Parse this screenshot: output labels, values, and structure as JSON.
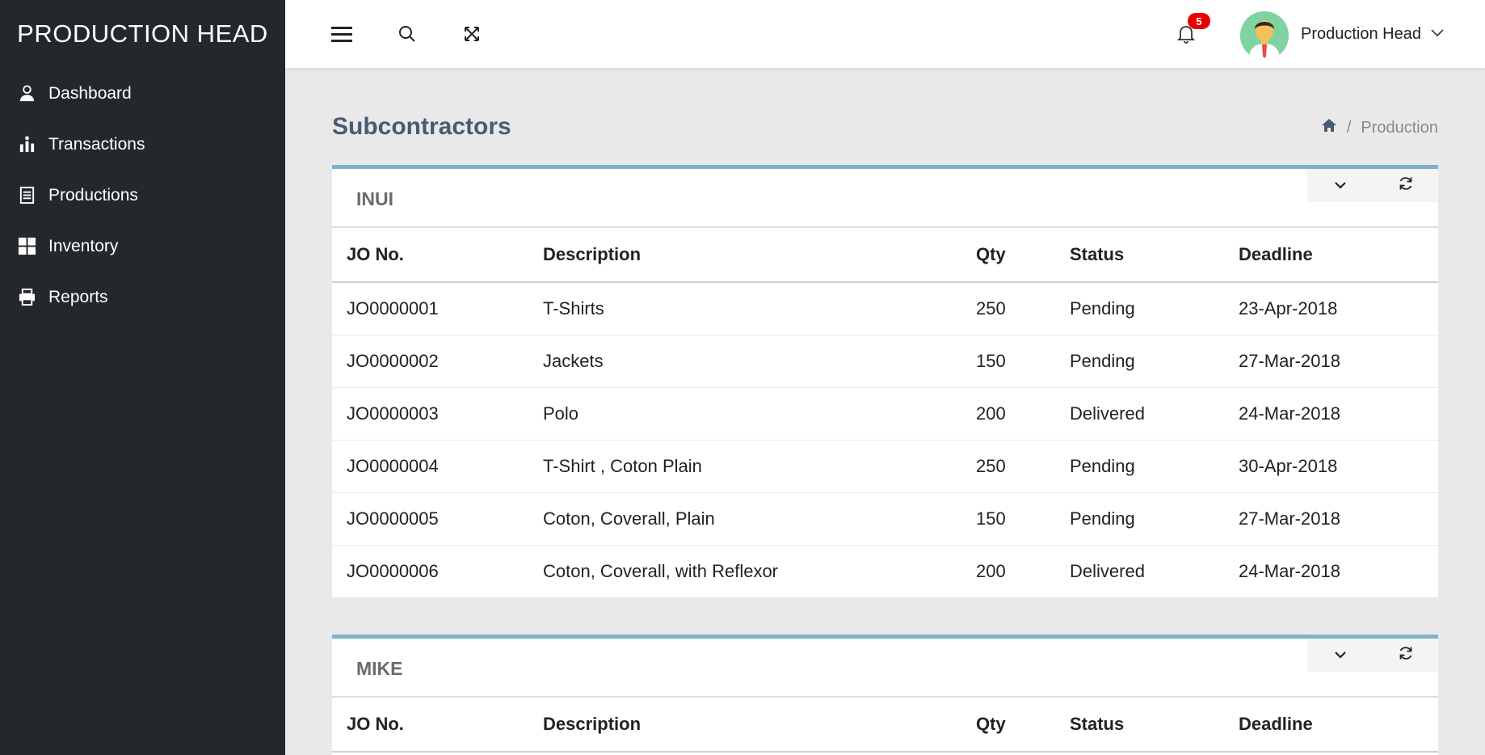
{
  "app": {
    "brand": "PRODUCTION HEAD"
  },
  "sidebar": {
    "items": [
      {
        "label": "Dashboard",
        "icon": "user-icon"
      },
      {
        "label": "Transactions",
        "icon": "transactions-icon"
      },
      {
        "label": "Productions",
        "icon": "document-icon"
      },
      {
        "label": "Inventory",
        "icon": "grid-icon"
      },
      {
        "label": "Reports",
        "icon": "printer-icon"
      }
    ]
  },
  "topbar": {
    "notification_count": "5",
    "user_name": "Production Head"
  },
  "page": {
    "title": "Subcontractors",
    "breadcrumb": {
      "separator": "/",
      "current": "Production"
    }
  },
  "panels": [
    {
      "title": "INUI",
      "columns": [
        "JO No.",
        "Description",
        "Qty",
        "Status",
        "Deadline"
      ],
      "rows": [
        [
          "JO0000001",
          "T-Shirts",
          "250",
          "Pending",
          "23-Apr-2018"
        ],
        [
          "JO0000002",
          "Jackets",
          "150",
          "Pending",
          "27-Mar-2018"
        ],
        [
          "JO0000003",
          "Polo",
          "200",
          "Delivered",
          "24-Mar-2018"
        ],
        [
          "JO0000004",
          "T-Shirt , Coton Plain",
          "250",
          "Pending",
          "30-Apr-2018"
        ],
        [
          "JO0000005",
          "Coton, Coverall, Plain",
          "150",
          "Pending",
          "27-Mar-2018"
        ],
        [
          "JO0000006",
          "Coton, Coverall, with Reflexor",
          "200",
          "Delivered",
          "24-Mar-2018"
        ]
      ]
    },
    {
      "title": "MIKE",
      "columns": [
        "JO No.",
        "Description",
        "Qty",
        "Status",
        "Deadline"
      ],
      "rows": []
    }
  ],
  "colors": {
    "sidebar_bg": "#24282c",
    "panel_accent": "#7fb1cf",
    "title": "#4a5a75",
    "badge": "#e60000"
  }
}
